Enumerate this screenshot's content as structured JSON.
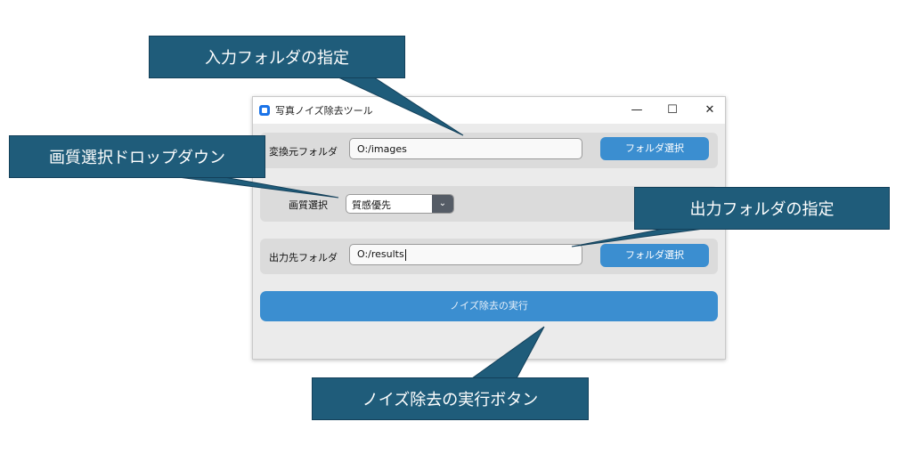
{
  "window": {
    "title": "写真ノイズ除去ツール",
    "controls": {
      "minimize": "—",
      "maximize": "☐",
      "close": "✕"
    }
  },
  "source": {
    "label": "変換元フォルダ",
    "value": "O:/images",
    "button_label": "フォルダ選択"
  },
  "quality": {
    "label": "画質選択",
    "selected": "質感優先",
    "arrow": "⌄"
  },
  "output": {
    "label": "出力先フォルダ",
    "value": "O:/results",
    "button_label": "フォルダ選択"
  },
  "run_button_label": "ノイズ除去の実行",
  "callouts": {
    "input_folder": "入力フォルダの指定",
    "quality_dropdown": "画質選択ドロップダウン",
    "output_folder": "出力フォルダの指定",
    "run_button": "ノイズ除去の実行ボタン"
  },
  "colors": {
    "accent": "#3b8ed0",
    "callout": "#1f5c7a",
    "window_bg": "#ebebeb"
  }
}
